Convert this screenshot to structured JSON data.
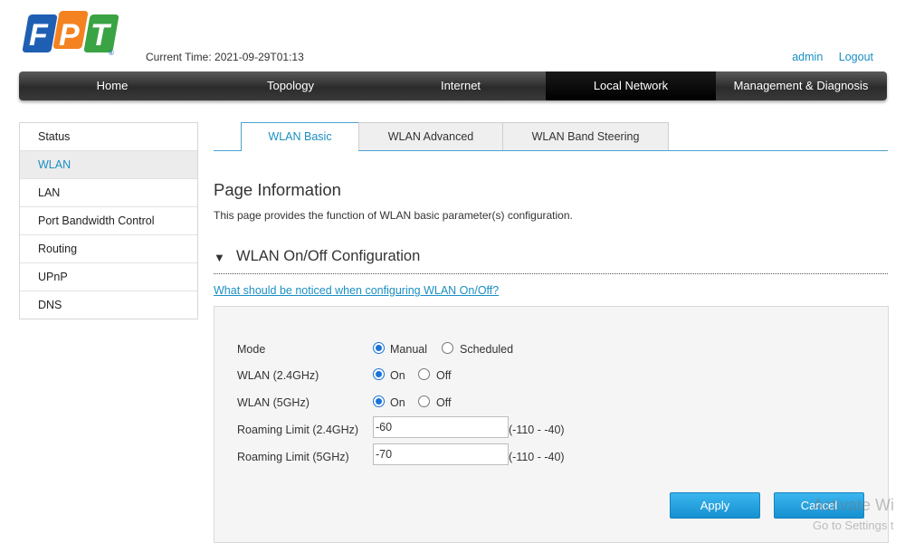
{
  "header": {
    "logo_letters": [
      "F",
      "P",
      "T"
    ],
    "logo_reg": "®",
    "current_time_label": "Current Time:",
    "current_time_value": "2021-09-29T01:13",
    "user_link": "admin",
    "logout_link": "Logout"
  },
  "nav": {
    "items": [
      "Home",
      "Topology",
      "Internet",
      "Local Network",
      "Management & Diagnosis"
    ],
    "active": "Local Network"
  },
  "sidebar": {
    "items": [
      "Status",
      "WLAN",
      "LAN",
      "Port Bandwidth Control",
      "Routing",
      "UPnP",
      "DNS"
    ],
    "active": "WLAN"
  },
  "tabs": {
    "items": [
      "WLAN Basic",
      "WLAN Advanced",
      "WLAN Band Steering"
    ],
    "active": "WLAN Basic"
  },
  "page": {
    "title": "Page Information",
    "description": "This page provides the function of WLAN basic parameter(s) configuration."
  },
  "section": {
    "toggle_icon": "▼",
    "title": "WLAN On/Off Configuration",
    "help_link": "What should be noticed when configuring WLAN On/Off?"
  },
  "form": {
    "mode": {
      "label": "Mode",
      "options": [
        "Manual",
        "Scheduled"
      ],
      "selected": "Manual"
    },
    "wlan24": {
      "label": "WLAN (2.4GHz)",
      "options": [
        "On",
        "Off"
      ],
      "selected": "On"
    },
    "wlan5": {
      "label": "WLAN (5GHz)",
      "options": [
        "On",
        "Off"
      ],
      "selected": "On"
    },
    "roaming24": {
      "label": "Roaming Limit (2.4GHz)",
      "value": "-60",
      "range": "(-110 - -40)"
    },
    "roaming5": {
      "label": "Roaming Limit (5GHz)",
      "value": "-70",
      "range": "(-110 - -40)"
    }
  },
  "buttons": {
    "apply": "Apply",
    "cancel": "Cancel"
  },
  "watermark": {
    "line1": "Activate Wi",
    "line2": "Go to Settings t"
  },
  "colors": {
    "accent": "#1a8fc2",
    "button": "#1a9ee0",
    "nav_bg": "#3a3a3a",
    "nav_active": "#000000"
  }
}
